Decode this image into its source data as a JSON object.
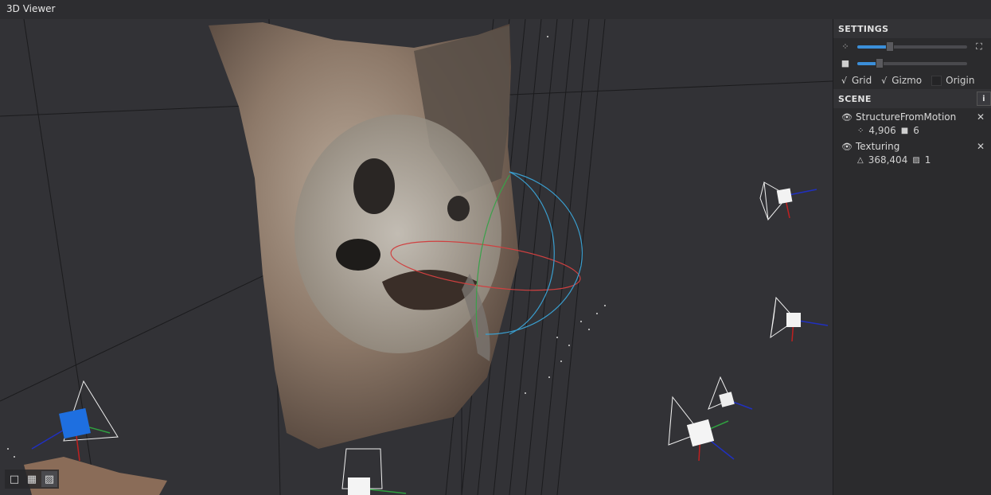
{
  "window": {
    "title": "3D Viewer"
  },
  "settings": {
    "heading": "SETTINGS",
    "point_size": {
      "icon": "points-icon",
      "value": 0.3,
      "end_icon": "fit-view-icon"
    },
    "camera_scale": {
      "icon": "camera-icon",
      "value": 0.2
    },
    "toggles": [
      {
        "label": "Grid",
        "checked": true
      },
      {
        "label": "Gizmo",
        "checked": true
      },
      {
        "label": "Origin",
        "checked": false
      }
    ]
  },
  "scene": {
    "heading": "SCENE",
    "info_icon": "info-icon",
    "items": [
      {
        "name": "StructureFromMotion",
        "stat1": "4,906",
        "stat1_icon": "points-icon",
        "stat2": "6",
        "stat2_icon": "camera-icon"
      },
      {
        "name": "Texturing",
        "stat1": "368,404",
        "stat1_icon": "triangle-icon",
        "stat2": "1",
        "stat2_icon": "texture-icon"
      }
    ]
  },
  "render_modes": [
    {
      "icon": "solid-mode-icon",
      "active": false
    },
    {
      "icon": "wireframe-mode-icon",
      "active": false
    },
    {
      "icon": "textured-mode-icon",
      "active": true
    }
  ],
  "colors": {
    "accent": "#3b8fd9",
    "selected_camera": "#1e6fe0",
    "gizmo_x": "#d04040",
    "gizmo_y": "#3aa04a",
    "gizmo_z": "#3a9fd0"
  }
}
